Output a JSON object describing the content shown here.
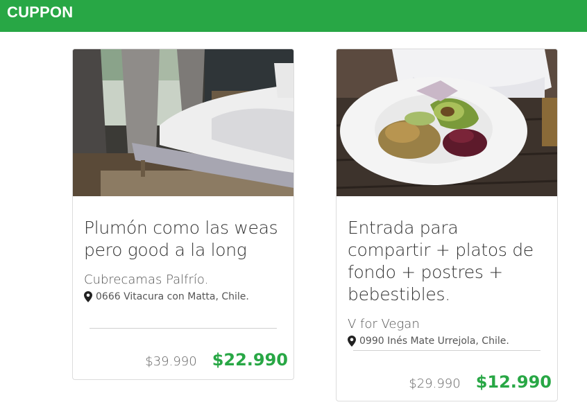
{
  "navbar": {
    "brand": "CUPPON",
    "color": "#28a745"
  },
  "cards": [
    {
      "image_alt": "bedroom-bed-photo",
      "title": "Plumón como las weas pero good a la long",
      "merchant": "Cubrecamas Palfrío.",
      "address": "0666 Vitacura con Matta, Chile.",
      "old_price": "$39.990",
      "new_price": "$22.990"
    },
    {
      "image_alt": "vegan-salad-bowl-photo",
      "title": "Entrada para compartir + platos de fondo + postres + bebestibles.",
      "merchant": "V for Vegan",
      "address": "0990 Inés Mate Urrejola, Chile.",
      "old_price": "$29.990",
      "new_price": "$12.990"
    }
  ],
  "icons": {
    "location": "map-marker-icon"
  }
}
